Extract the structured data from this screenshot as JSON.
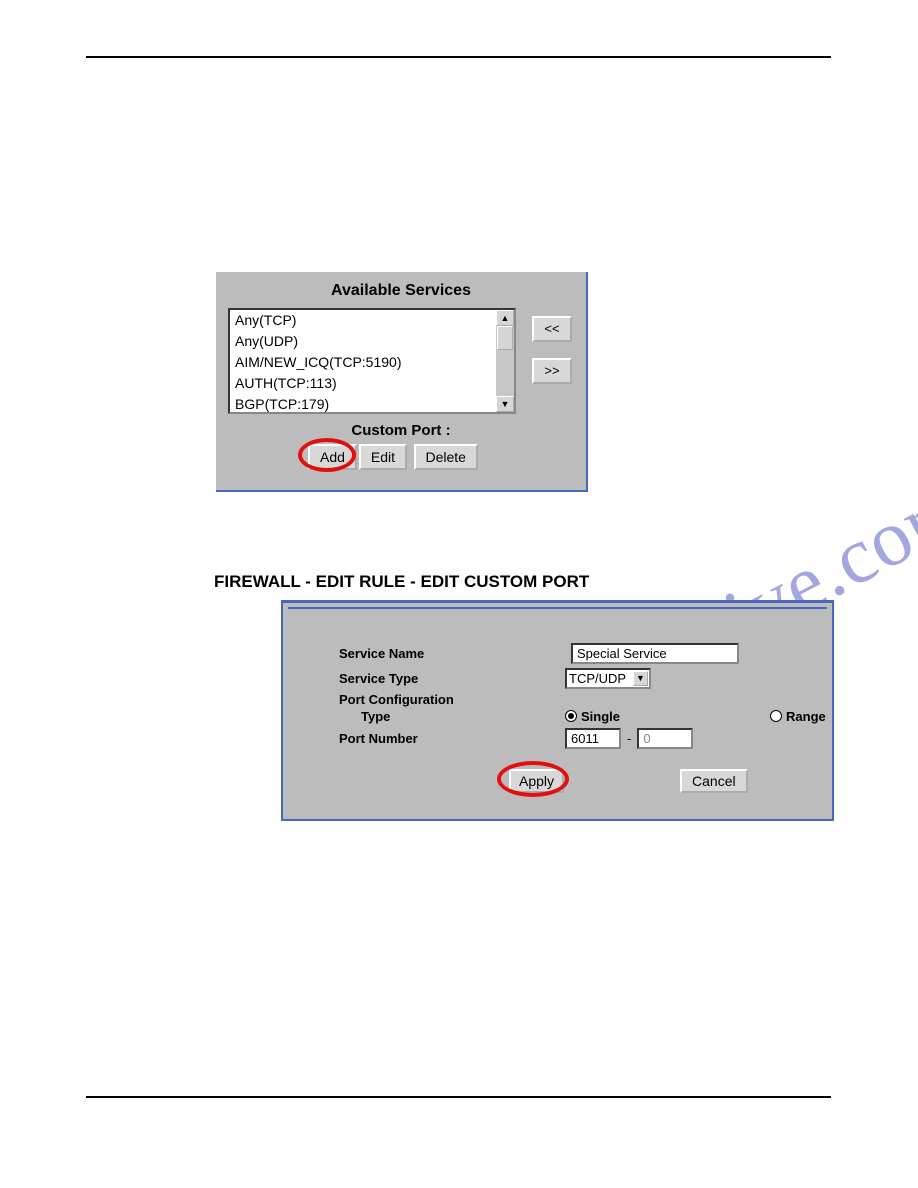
{
  "watermark": "manualshive.com",
  "panel1": {
    "title": "Available Services",
    "items": [
      "Any(TCP)",
      "Any(UDP)",
      "AIM/NEW_ICQ(TCP:5190)",
      "AUTH(TCP:113)",
      "BGP(TCP:179)"
    ],
    "move_left": "<<",
    "move_right": ">>",
    "custom_port_label": "Custom Port :",
    "add": "Add",
    "edit": "Edit",
    "delete": "Delete"
  },
  "heading": "FIREWALL - EDIT RULE - EDIT CUSTOM PORT",
  "panel2": {
    "service_name_label": "Service Name",
    "service_name_value": "Special Service",
    "service_type_label": "Service Type",
    "service_type_value": "TCP/UDP",
    "port_config_label": "Port Configuration",
    "type_label": "Type",
    "type_single": "Single",
    "type_range": "Range",
    "port_number_label": "Port Number",
    "port1": "6011",
    "port2": "0",
    "apply": "Apply",
    "cancel": "Cancel"
  }
}
